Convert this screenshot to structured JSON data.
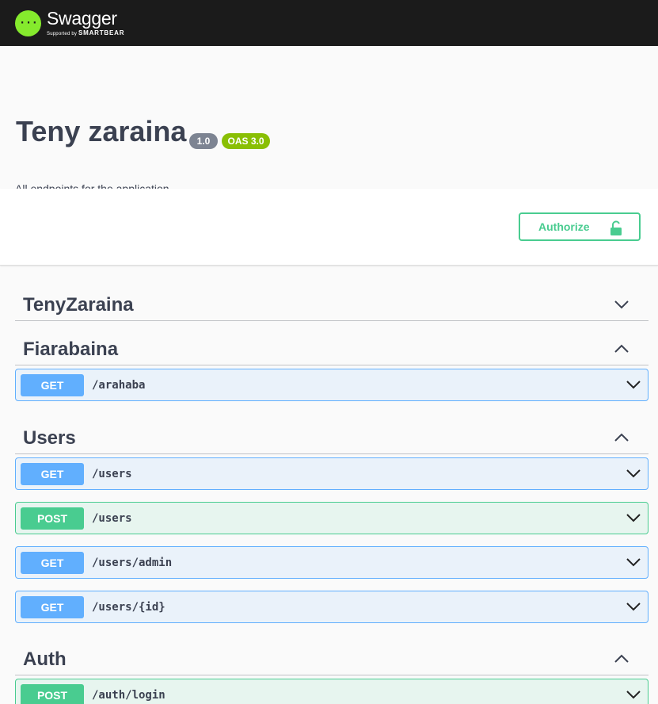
{
  "topbar": {
    "logo_name": "Swagger",
    "logo_sub_prefix": "Supported by",
    "logo_sub_brand": "SMARTBEAR",
    "logo_glyph": "{···}"
  },
  "info": {
    "title": "Teny zaraina",
    "version_badge": "1.0",
    "oas_badge": "OAS 3.0",
    "description": "All endpoints for the application"
  },
  "auth": {
    "authorize_label": "Authorize"
  },
  "tags": [
    {
      "name": "TenyZaraina",
      "expanded": false
    },
    {
      "name": "Fiarabaina",
      "expanded": true
    },
    {
      "name": "Users",
      "expanded": true
    },
    {
      "name": "Auth",
      "expanded": true
    }
  ],
  "operations": [
    {
      "method": "GET",
      "path": "/arahaba"
    },
    {
      "method": "GET",
      "path": "/users"
    },
    {
      "method": "POST",
      "path": "/users"
    },
    {
      "method": "GET",
      "path": "/users/admin"
    },
    {
      "method": "GET",
      "path": "/users/{id}"
    },
    {
      "method": "POST",
      "path": "/auth/login"
    }
  ],
  "colors": {
    "get": "#61affe",
    "post": "#49cc90",
    "logo_green": "#85ea2d",
    "oas_badge": "#89bf04",
    "version_badge": "#7d8492"
  }
}
